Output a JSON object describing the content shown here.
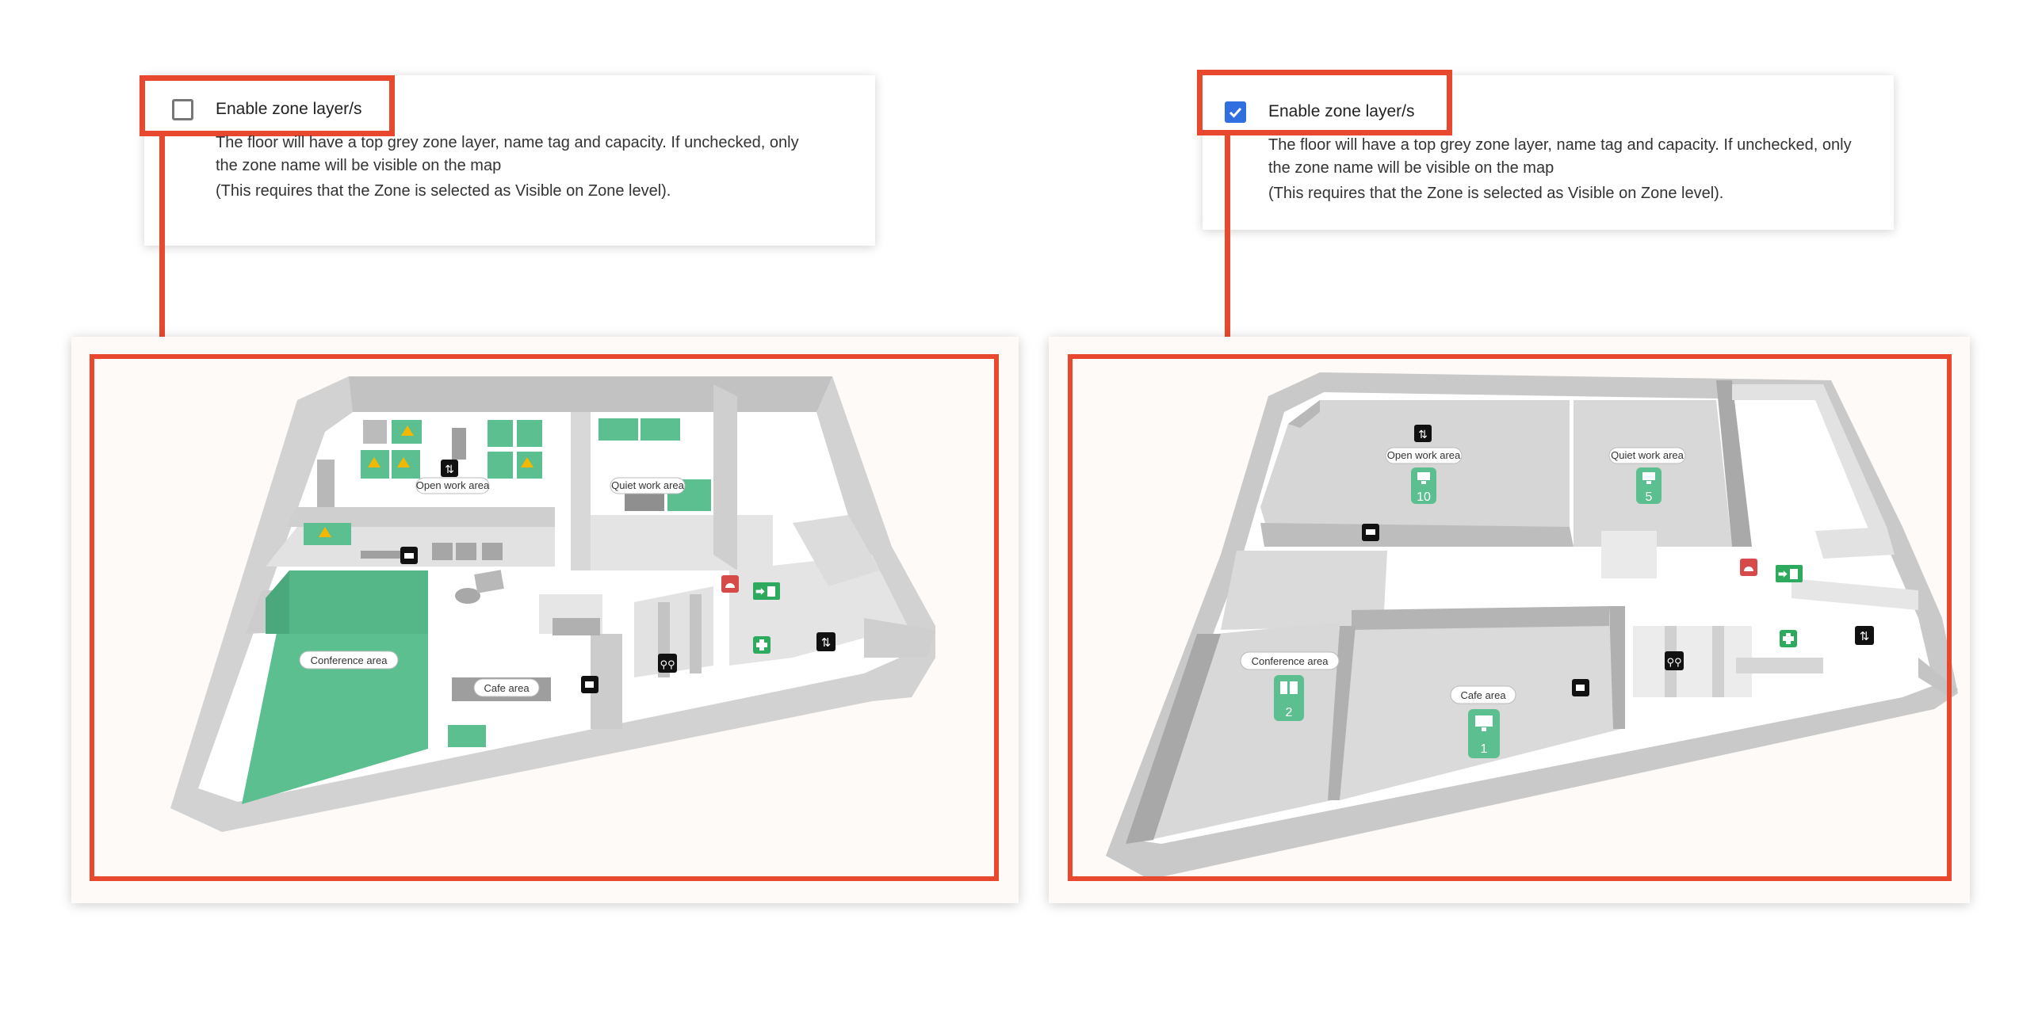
{
  "left_panel": {
    "checkbox_label": "Enable zone layer/s",
    "checkbox_checked": false,
    "description_line1": "The floor will have a top grey zone layer, name tag and capacity. If unchecked, only",
    "description_line2": "the zone name will be visible on the map",
    "description_line3": "(This requires that the Zone is selected as Visible on Zone level).",
    "map": {
      "zone_labels": {
        "open_work": "Open work area",
        "quiet_work": "Quiet work area",
        "conference": "Conference area",
        "cafe": "Cafe area"
      }
    }
  },
  "right_panel": {
    "checkbox_label": "Enable zone layer/s",
    "checkbox_checked": true,
    "description_line1": "The floor will have a top grey zone layer, name tag and capacity. If unchecked, only",
    "description_line2": "the zone name will be visible on the map",
    "description_line3": "(This requires that the Zone is selected as Visible on Zone level).",
    "map": {
      "zone_labels": {
        "open_work": "Open work area",
        "quiet_work": "Quiet work area",
        "conference": "Conference area",
        "cafe": "Cafe area"
      },
      "capacities": {
        "open_work": "10",
        "quiet_work": "5",
        "conference": "2",
        "cafe": "1"
      }
    }
  },
  "colors": {
    "highlight": "#e8492e",
    "checkbox_checked": "#2f6fe0",
    "zone_green": "#5bbf8f",
    "wall_grey": "#c9c9c9",
    "floor": "#ffffff"
  },
  "icons": [
    "elevator-icon",
    "printer-icon",
    "coffee-icon",
    "restroom-icon",
    "first-aid-icon",
    "emergency-exit-icon",
    "fire-alarm-icon",
    "warning-icon",
    "desk-icon",
    "meeting-room-icon"
  ]
}
